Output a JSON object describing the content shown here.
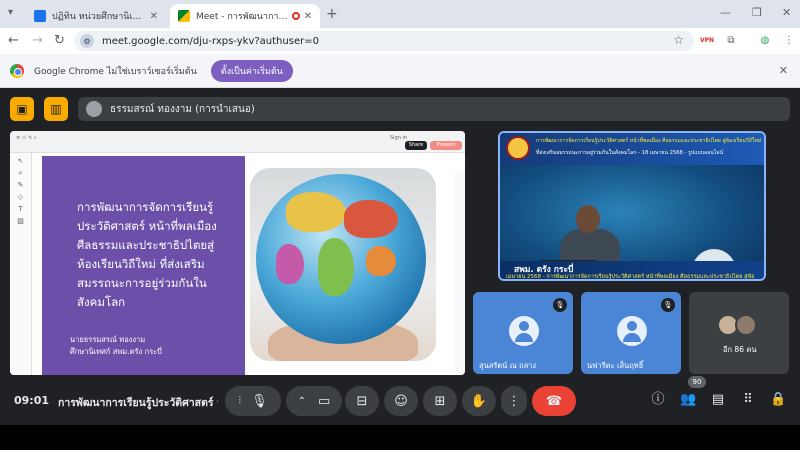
{
  "browser": {
    "tabs": [
      {
        "title": "ปฏิทิน หน่วยศึกษานิเทศก์ สพฐ. - นิ",
        "active": false
      },
      {
        "title": "Meet - การพัฒนาการเรียนรู้ประ",
        "active": true
      }
    ],
    "new_tab": "+",
    "url": "meet.google.com/dju-rxps-ykv?authuser=0",
    "infobar_message": "Google Chrome ไม่ใช่เบราว์เซอร์เริ่มต้น",
    "infobar_button": "ตั้งเป็นค่าเริ่มต้น",
    "ext_vpn": "VPN",
    "colors": {
      "tabbar": "#dfe3eb",
      "accent": "#7c5fc1"
    }
  },
  "meet": {
    "presenter": "ธรรมสรณ์ ทองงาม (การนำเสนอ)",
    "slide": {
      "title_lines": [
        "การพัฒนาการจัดการเรียนรู้",
        "ประวัติศาสตร์ หน้าที่พลเมือง",
        "ศีลธรรมและประชาธิปไตยสู่",
        "ห้องเรียนวิถีใหม่ ที่ส่งเสริม",
        "สมรรถนะการอยู่ร่วมกันใน",
        "สังคมโลก"
      ],
      "author_lines": [
        "นายธรรมสรณ์ ทองงาม",
        "ศึกษานิเทศก์ สพม.ตรัง กระบี่"
      ],
      "toolbar_title": "Sign in",
      "share": "Share",
      "present": "Present"
    },
    "main_video": {
      "banner_line1": "การพัฒนาการจัดการเรียนรู้ประวัติศาสตร์ หน้าที่พลเมือง ศีลธรรมและประชาธิปไตย สู่ห้องเรียนวิถีใหม่",
      "banner_line2": "ที่ส่งเสริมสมรรถนะการอยู่ร่วมกันในสังคมโลก - 18 เมษายน 2568 - รูปแบบออนไลน์",
      "lower_name": "สพม. ตรัง กระบี่",
      "lower_sub": "เมษายน 2568 - การพัฒนาการจัดการเรียนรู้ประวัติศาสตร์ หน้าที่พลเมือง ศีลธรรมและประชาธิปไตย สู่ห้อ"
    },
    "tiles": [
      {
        "name": "สุนสรัตน์ ณ ถลาง",
        "muted": true
      },
      {
        "name": "นฟารีดะ เส็นฤทธิ์",
        "muted": true
      },
      {
        "name": "อีก 86 คน",
        "muted": false
      }
    ],
    "time": "09:01",
    "meeting_title": "การพัฒนาการเรียนรู้ประวัติศาสตร์ หน้...",
    "participant_count": "90",
    "colors": {
      "end_call": "#ea4335",
      "tile": "#4b86d6",
      "control": "#3c4043"
    }
  }
}
